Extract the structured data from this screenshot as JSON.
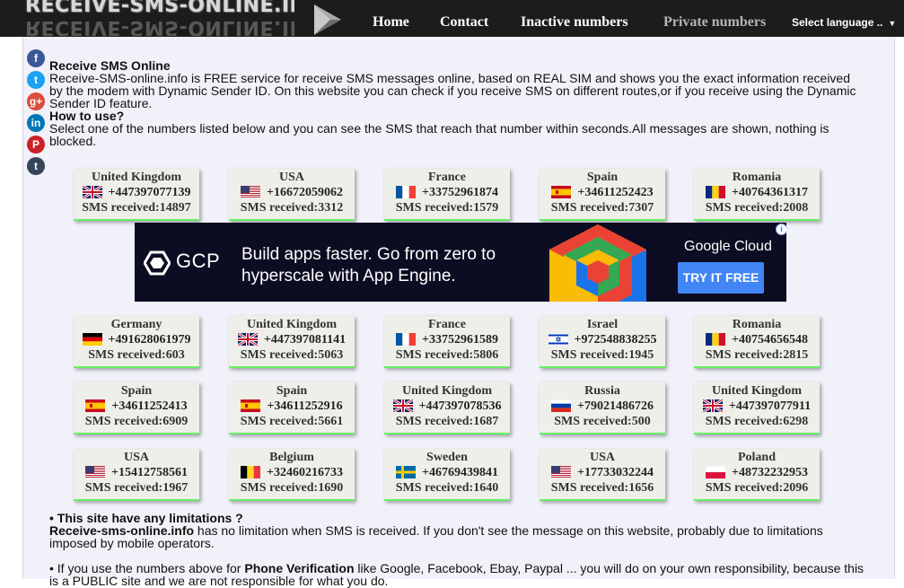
{
  "header": {
    "logo_text": "RECEIVE-SMS-ONLINE.INFO",
    "nav": {
      "home": "Home",
      "contact": "Contact",
      "inactive": "Inactive numbers",
      "private": "Private numbers"
    },
    "language": "Select language ..",
    "language_arrow": "▼"
  },
  "social": [
    {
      "name": "facebook-icon",
      "glyph": "f",
      "color": "#3b5998"
    },
    {
      "name": "twitter-icon",
      "glyph": "t",
      "color": "#1da1f2"
    },
    {
      "name": "googleplus-icon",
      "glyph": "g+",
      "color": "#dd4b39"
    },
    {
      "name": "linkedin-icon",
      "glyph": "in",
      "color": "#0077b5"
    },
    {
      "name": "pinterest-icon",
      "glyph": "P",
      "color": "#cb2027"
    },
    {
      "name": "tumblr-icon",
      "glyph": "t",
      "color": "#35465c"
    }
  ],
  "intro": {
    "title": "Receive SMS Online",
    "description": "Receive-SMS-online.info is FREE service for receive SMS messages online, based on REAL SIM and shows you the exact information received by the modem with Dynamic Sender ID. On this website you can check if you receive SMS on different routes,or if you receive using the Dynamic Sender ID feature.",
    "howto_title": "How to use?",
    "howto_text": "Select one of the numbers listed below and you can see the SMS that reach that number within seconds.All messages are shown, nothing is blocked."
  },
  "numbers": [
    {
      "country": "United Kingdom",
      "flag": "uk",
      "number": "+447397077139",
      "sms": "SMS received:14897"
    },
    {
      "country": "USA",
      "flag": "us",
      "number": "+16672059062",
      "sms": "SMS received:3312"
    },
    {
      "country": "France",
      "flag": "fr",
      "number": "+33752961874",
      "sms": "SMS received:1579"
    },
    {
      "country": "Spain",
      "flag": "es",
      "number": "+34611252423",
      "sms": "SMS received:7307"
    },
    {
      "country": "Romania",
      "flag": "ro",
      "number": "+40764361317",
      "sms": "SMS received:2008"
    },
    {
      "country": "Germany",
      "flag": "de",
      "number": "+491628061979",
      "sms": "SMS received:603"
    },
    {
      "country": "United Kingdom",
      "flag": "uk",
      "number": "+447397081141",
      "sms": "SMS received:5063"
    },
    {
      "country": "France",
      "flag": "fr",
      "number": "+33752961589",
      "sms": "SMS received:5806"
    },
    {
      "country": "Israel",
      "flag": "il",
      "number": "+972548838255",
      "sms": "SMS received:1945"
    },
    {
      "country": "Romania",
      "flag": "ro",
      "number": "+40754656548",
      "sms": "SMS received:2815"
    },
    {
      "country": "Spain",
      "flag": "es",
      "number": "+34611252413",
      "sms": "SMS received:6909"
    },
    {
      "country": "Spain",
      "flag": "es",
      "number": "+34611252916",
      "sms": "SMS received:5661"
    },
    {
      "country": "United Kingdom",
      "flag": "uk",
      "number": "+447397078536",
      "sms": "SMS received:1687"
    },
    {
      "country": "Russia",
      "flag": "ru",
      "number": "+79021486726",
      "sms": "SMS received:500"
    },
    {
      "country": "United Kingdom",
      "flag": "uk",
      "number": "+447397077911",
      "sms": "SMS received:6298"
    },
    {
      "country": "USA",
      "flag": "us",
      "number": "+15412758561",
      "sms": "SMS received:1967"
    },
    {
      "country": "Belgium",
      "flag": "be",
      "number": "+32460216733",
      "sms": "SMS received:1690"
    },
    {
      "country": "Sweden",
      "flag": "se",
      "number": "+46769439841",
      "sms": "SMS received:1640"
    },
    {
      "country": "USA",
      "flag": "us",
      "number": "+17733032244",
      "sms": "SMS received:1656"
    },
    {
      "country": "Poland",
      "flag": "pl",
      "number": "+48732232953",
      "sms": "SMS received:2096"
    }
  ],
  "ad": {
    "brand": "GCP",
    "headline": "Build apps faster. Go from zero to hyperscale with App Engine.",
    "company": "Google Cloud",
    "cta": "TRY IT FREE",
    "info_glyph": "i"
  },
  "limits": {
    "bullet1_title": "• This site have any limitations ?",
    "bullet1_site": "Receive-sms-online.info",
    "bullet1_text": " has no limitation when SMS is received. If you don't see the message on this website, probably due to limitations imposed by mobile operators.",
    "bullet2_prefix": "• If you use the numbers above for ",
    "bullet2_bold": "Phone Verification",
    "bullet2_text": " like Google, Facebook, Ebay, Paypal ... you will do on your own responsibility, because this is a PUBLIC site and we are not responsible for what you do."
  }
}
